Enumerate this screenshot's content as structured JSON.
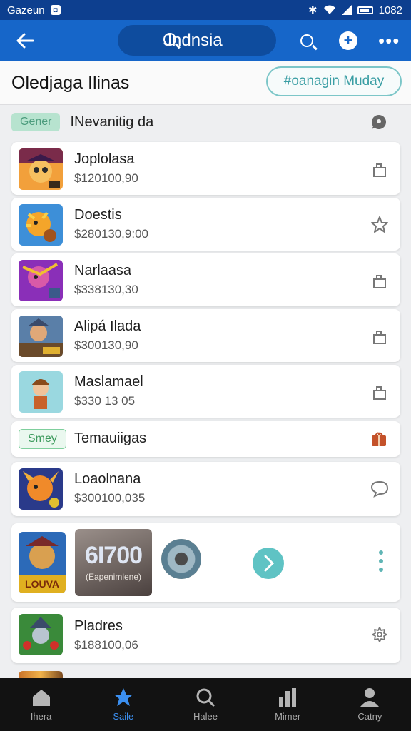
{
  "status_bar": {
    "left_text": "Gazeun",
    "time": "1082"
  },
  "app_bar": {
    "search_text": "Jndnsia"
  },
  "header": {
    "title": "Oledjaga Ilinas",
    "pill_label": "#oanagin Muday"
  },
  "sections": [
    {
      "tag": "Gener",
      "label": "INevanitig da",
      "tag_color": "#a9dcc6",
      "tag_text_color": "#5aa88a"
    },
    {
      "tag": "Smey",
      "label": "Temauiigas",
      "tag_color": "#e9f7ee",
      "tag_text_color": "#3e9b5e"
    }
  ],
  "items": [
    {
      "name": "Joplolasa",
      "price": "$120100,90",
      "action_icon": "share-icon"
    },
    {
      "name": "Doestis",
      "price": "$280130,9:00",
      "action_icon": "star-icon"
    },
    {
      "name": "Narlaasa",
      "price": "$338130,30",
      "action_icon": "share-icon"
    },
    {
      "name": "Alipá Ilada",
      "price": "$300130,90",
      "action_icon": "share-icon"
    },
    {
      "name": "Maslamael",
      "price": "$330 13 05",
      "action_icon": "share-icon"
    },
    {
      "name": "Loaolnana",
      "price": "$300100,035",
      "action_icon": "chat-icon"
    },
    {
      "name": "Pladres",
      "price": "$188100,06",
      "action_icon": "gear-icon"
    }
  ],
  "featured": {
    "amount": "6I700",
    "caption": "(Eapenimlene)"
  },
  "bottom_nav": [
    {
      "label": "Ihera",
      "icon": "home-icon",
      "active": false
    },
    {
      "label": "Saile",
      "icon": "star-icon",
      "active": true
    },
    {
      "label": "Halee",
      "icon": "search-icon",
      "active": false
    },
    {
      "label": "Mimer",
      "icon": "chart-icon",
      "active": false
    },
    {
      "label": "Catny",
      "icon": "profile-icon",
      "active": false
    }
  ],
  "colors": {
    "app_bar": "#1666c9",
    "status_bar": "#0d3f8f",
    "accent": "#5fc3c4",
    "nav_active": "#3b8ff0"
  }
}
